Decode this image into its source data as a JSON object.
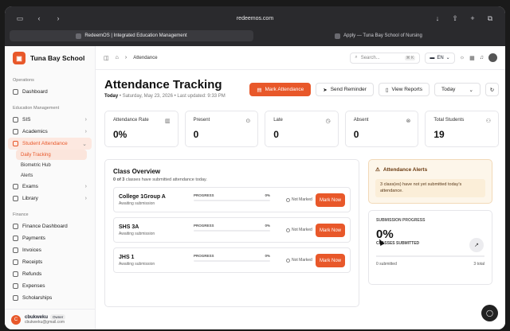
{
  "browser": {
    "url": "redeemos.com",
    "tabs": [
      {
        "label": "RedeemOS | Integrated Education Management"
      },
      {
        "label": "Apply — Tuna Bay School of Nursing"
      }
    ]
  },
  "brand": {
    "name": "Tuna Bay School"
  },
  "sidebar": {
    "sections": [
      "Operations",
      "Education Management",
      "Finance"
    ],
    "dashboard": "Dashboard",
    "sis": "SIS",
    "academics": "Academics",
    "student_attendance": "Student Attendance",
    "sub_items": [
      "Daily Tracking",
      "Biometric Hub",
      "Alerts"
    ],
    "exams": "Exams",
    "library": "Library",
    "finance_items": [
      "Finance Dashboard",
      "Payments",
      "Invoices",
      "Receipts",
      "Refunds",
      "Expenses",
      "Scholarships"
    ]
  },
  "user": {
    "name": "cbukweku",
    "role": "Owner",
    "email": "cbukweku@gmail.com",
    "initial": "C"
  },
  "topbar": {
    "breadcrumb": "Attendance",
    "search_placeholder": "Search...",
    "shortcut": "⌘ K",
    "language": "EN"
  },
  "page": {
    "title": "Attendance Tracking",
    "today_label": "Today",
    "date": "Saturday, May 23, 2026",
    "last_updated": "Last updated: 9:33 PM"
  },
  "actions": {
    "mark": "Mark Attendance",
    "remind": "Send Reminder",
    "reports": "View Reports",
    "period": "Today"
  },
  "stats": [
    {
      "label": "Attendance Rate",
      "value": "0%"
    },
    {
      "label": "Present",
      "value": "0"
    },
    {
      "label": "Late",
      "value": "0"
    },
    {
      "label": "Absent",
      "value": "0"
    },
    {
      "label": "Total Students",
      "value": "19"
    }
  ],
  "overview": {
    "title": "Class Overview",
    "subtitle_count": "0 of 3",
    "subtitle_rest": " classes have submitted attendance today.",
    "progress_label": "PROGRESS",
    "not_marked": "Not Marked",
    "mark_now": "Mark Now",
    "classes": [
      {
        "name": "College 1Group A",
        "status": "Awaiting submission",
        "progress": "0%",
        "fraction": 0
      },
      {
        "name": "SHS 3A",
        "status": "Awaiting submission",
        "progress": "0%",
        "fraction": 0
      },
      {
        "name": "JHS 1",
        "status": "Awaiting submission",
        "progress": "0%",
        "fraction": 0
      }
    ]
  },
  "alerts": {
    "title": "Attendance Alerts",
    "message": "3 class(es) have not yet submitted today's attendance."
  },
  "submission": {
    "label": "SUBMISSION PROGRESS",
    "value": "0%",
    "sub": "CLASSES SUBMITTED",
    "submitted": "0 submitted",
    "total": "3 total",
    "fraction": 0
  }
}
